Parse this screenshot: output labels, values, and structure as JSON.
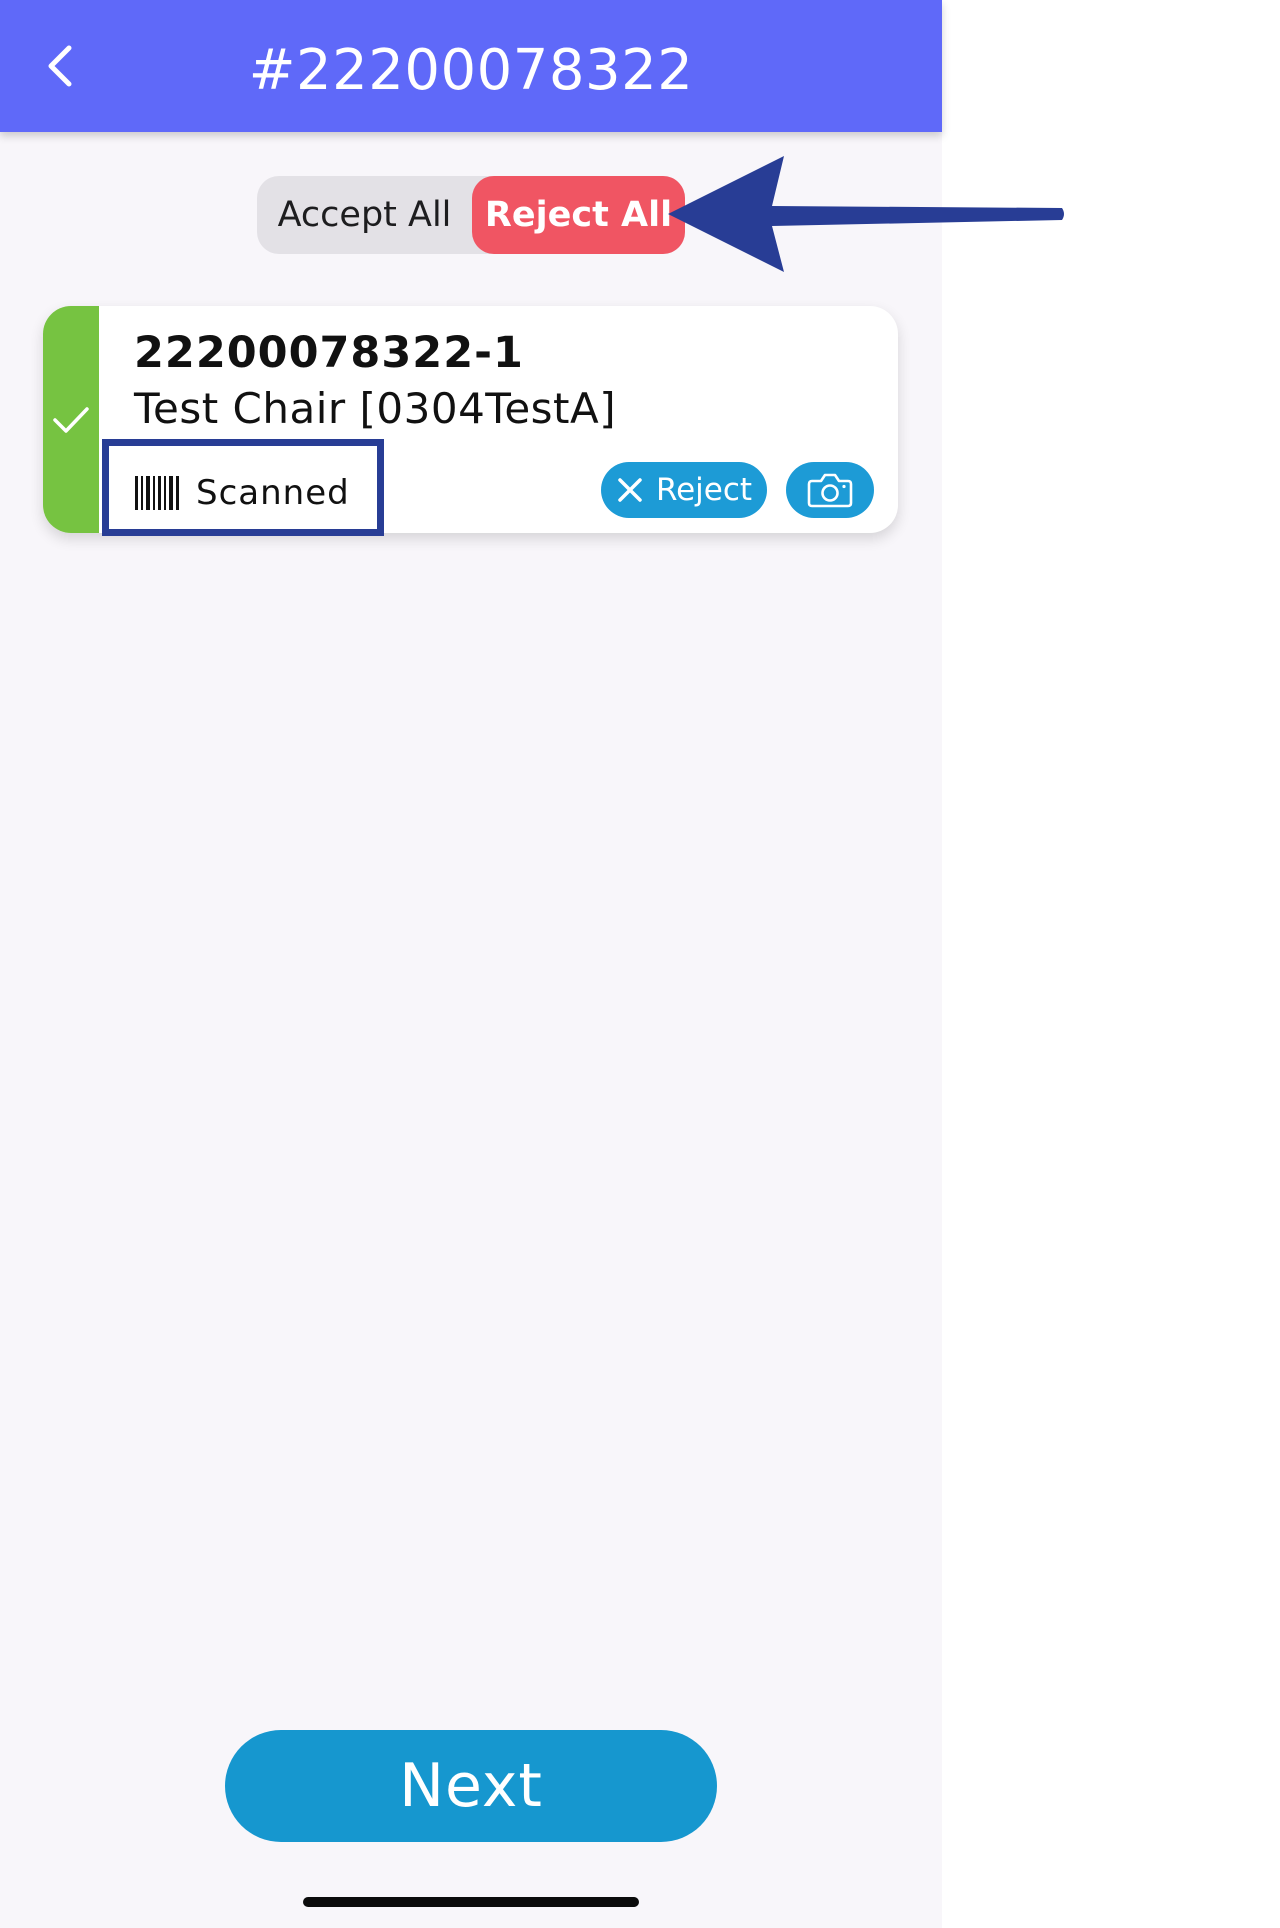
{
  "header": {
    "title": "#22200078322",
    "back_icon": "chevron-left-icon"
  },
  "bulk_actions": {
    "accept_all_label": "Accept All",
    "reject_all_label": "Reject All",
    "selected": "Reject All"
  },
  "items": [
    {
      "id": "22200078322-1",
      "name": "Test Chair [0304TestA]",
      "status_icon": "checkmark-icon",
      "scan_status_icon": "barcode-icon",
      "scan_status": "Scanned",
      "reject_label": "Reject",
      "reject_icon": "close-icon",
      "camera_icon": "camera-icon"
    }
  ],
  "footer": {
    "next_label": "Next"
  },
  "colors": {
    "header": "#5f69f9",
    "reject_all": "#f05563",
    "accepted_strip": "#76c341",
    "action_blue": "#1d9bd6",
    "annotation": "#283d95"
  }
}
